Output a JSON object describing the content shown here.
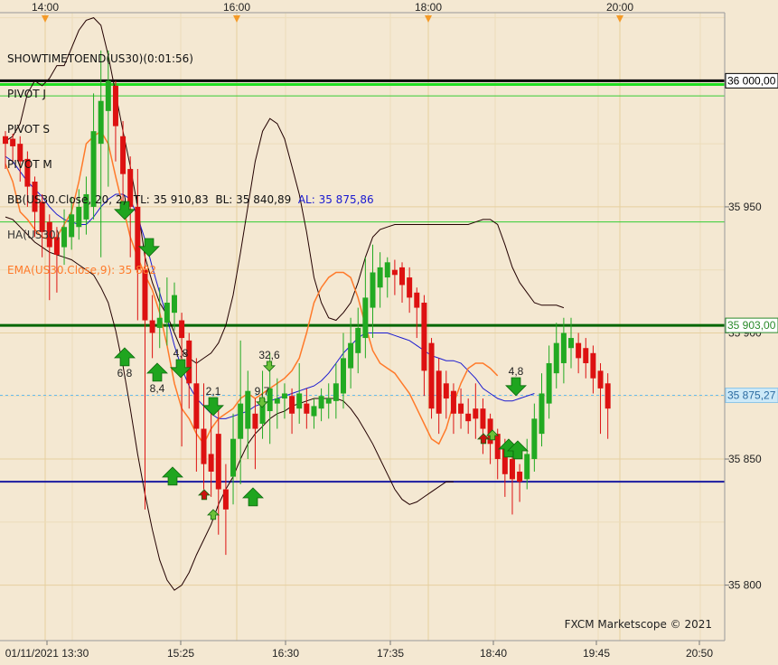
{
  "chart_data": {
    "type": "candlestick",
    "instrument": "US30",
    "y_range": [
      35778,
      36027
    ],
    "y_ticks": [
      {
        "value": 35800,
        "label": "35 800"
      },
      {
        "value": 35850,
        "label": "35 850"
      },
      {
        "value": 35900,
        "label": "35 900"
      },
      {
        "value": 35950,
        "label": "35 950"
      }
    ],
    "top_time_labels": [
      "14:00",
      "16:00",
      "18:00",
      "20:00"
    ],
    "bottom_time_labels": [
      "01/11/2021 13:30",
      "15:25",
      "16:30",
      "17:35",
      "18:40",
      "19:45",
      "20:50"
    ],
    "legend": [
      "SHOWTIMETOEND(US30)(0:01:56)",
      "PIVOT J",
      "PIVOT S",
      "PIVOT M",
      "BB(US30.Close, 20, 2)  TL: 35 910,83  BL: 35 840,89  AL: 35 875,86",
      "HA(US30)",
      "EMA(US30.Close,9): 35 882"
    ],
    "levels": [
      {
        "name": "PIVOT J",
        "value": 36000,
        "label": "36 000,00",
        "color": "#000000"
      },
      {
        "name": "PIVOT J zone",
        "value": 35998.5,
        "color": "#22dd22"
      },
      {
        "name": "PIVOT S",
        "value": 35994,
        "color": "#33cc33"
      },
      {
        "name": "PIVOT M",
        "value": 35944,
        "color": "#33cc33"
      },
      {
        "name": "PIVOT",
        "value": 35903,
        "label": "35 903,00",
        "color": "#006600"
      },
      {
        "name": "support",
        "value": 35841,
        "color": "#1a1aa0"
      },
      {
        "name": "current",
        "value": 35875.27,
        "label": "35 875,27",
        "color": "#66bbee"
      }
    ],
    "candles": [
      {
        "o": 35978,
        "c": 35975,
        "h": 35980,
        "l": 35965
      },
      {
        "o": 35977,
        "c": 35974,
        "h": 35979,
        "l": 35968
      },
      {
        "o": 35975,
        "c": 35968,
        "h": 35978,
        "l": 35960
      },
      {
        "o": 35969,
        "c": 35958,
        "h": 35972,
        "l": 35950
      },
      {
        "o": 35960,
        "c": 35948,
        "h": 35962,
        "l": 35938
      },
      {
        "o": 35952,
        "c": 35940,
        "h": 35955,
        "l": 35930
      },
      {
        "o": 35944,
        "c": 35934,
        "h": 35947,
        "l": 35913
      },
      {
        "o": 35938,
        "c": 35931,
        "h": 35942,
        "l": 35916
      },
      {
        "o": 35934,
        "c": 35942,
        "h": 35949,
        "l": 35927
      },
      {
        "o": 35938,
        "c": 35947,
        "h": 35954,
        "l": 35933
      },
      {
        "o": 35942,
        "c": 35950,
        "h": 35957,
        "l": 35937
      },
      {
        "o": 35945,
        "c": 35955,
        "h": 35962,
        "l": 35939
      },
      {
        "o": 35950,
        "c": 35980,
        "h": 35995,
        "l": 35945
      },
      {
        "o": 35975,
        "c": 35992,
        "h": 36012,
        "l": 35930
      },
      {
        "o": 35988,
        "c": 36000,
        "h": 36012,
        "l": 35958
      },
      {
        "o": 35998,
        "c": 35982,
        "h": 36000,
        "l": 35968
      },
      {
        "o": 35978,
        "c": 35963,
        "h": 35984,
        "l": 35950
      },
      {
        "o": 35965,
        "c": 35950,
        "h": 35970,
        "l": 35930
      },
      {
        "o": 35950,
        "c": 35925,
        "h": 35965,
        "l": 35905
      },
      {
        "o": 35925,
        "c": 35905,
        "h": 35935,
        "l": 35830
      },
      {
        "o": 35905,
        "c": 35900,
        "h": 35915,
        "l": 35890
      },
      {
        "o": 35902,
        "c": 35906,
        "h": 35918,
        "l": 35894
      },
      {
        "o": 35904,
        "c": 35912,
        "h": 35922,
        "l": 35895
      },
      {
        "o": 35908,
        "c": 35915,
        "h": 35920,
        "l": 35901
      },
      {
        "o": 35905,
        "c": 35898,
        "h": 35908,
        "l": 35855
      },
      {
        "o": 35897,
        "c": 35880,
        "h": 35900,
        "l": 35870
      },
      {
        "o": 35880,
        "c": 35862,
        "h": 35890,
        "l": 35845
      },
      {
        "o": 35862,
        "c": 35848,
        "h": 35880,
        "l": 35838
      },
      {
        "o": 35852,
        "c": 35845,
        "h": 35870,
        "l": 35835
      },
      {
        "o": 35860,
        "c": 35838,
        "h": 35870,
        "l": 35820
      },
      {
        "o": 35838,
        "c": 35830,
        "h": 35848,
        "l": 35812
      },
      {
        "o": 35843,
        "c": 35858,
        "h": 35868,
        "l": 35832
      },
      {
        "o": 35858,
        "c": 35872,
        "h": 35897,
        "l": 35840
      },
      {
        "o": 35862,
        "c": 35877,
        "h": 35885,
        "l": 35850
      },
      {
        "o": 35868,
        "c": 35862,
        "h": 35874,
        "l": 35846
      },
      {
        "o": 35864,
        "c": 35874,
        "h": 35885,
        "l": 35858
      },
      {
        "o": 35869,
        "c": 35878,
        "h": 35892,
        "l": 35856
      },
      {
        "o": 35872,
        "c": 35874,
        "h": 35882,
        "l": 35862
      },
      {
        "o": 35874,
        "c": 35876,
        "h": 35880,
        "l": 35866
      },
      {
        "o": 35875,
        "c": 35868,
        "h": 35878,
        "l": 35860
      },
      {
        "o": 35870,
        "c": 35876,
        "h": 35888,
        "l": 35864
      },
      {
        "o": 35872,
        "c": 35868,
        "h": 35878,
        "l": 35862
      },
      {
        "o": 35867,
        "c": 35871,
        "h": 35874,
        "l": 35862
      },
      {
        "o": 35870,
        "c": 35875,
        "h": 35878,
        "l": 35865
      },
      {
        "o": 35872,
        "c": 35874,
        "h": 35880,
        "l": 35866
      },
      {
        "o": 35873,
        "c": 35880,
        "h": 35888,
        "l": 35866
      },
      {
        "o": 35876,
        "c": 35890,
        "h": 35900,
        "l": 35870
      },
      {
        "o": 35886,
        "c": 35896,
        "h": 35906,
        "l": 35878
      },
      {
        "o": 35892,
        "c": 35902,
        "h": 35910,
        "l": 35884
      },
      {
        "o": 35898,
        "c": 35914,
        "h": 35930,
        "l": 35890
      },
      {
        "o": 35910,
        "c": 35924,
        "h": 35935,
        "l": 35898
      },
      {
        "o": 35918,
        "c": 35926,
        "h": 35932,
        "l": 35910
      },
      {
        "o": 35922,
        "c": 35928,
        "h": 35930,
        "l": 35914
      },
      {
        "o": 35925,
        "c": 35923,
        "h": 35929,
        "l": 35915
      },
      {
        "o": 35926,
        "c": 35919,
        "h": 35928,
        "l": 35912
      },
      {
        "o": 35922,
        "c": 35914,
        "h": 35926,
        "l": 35908
      },
      {
        "o": 35916,
        "c": 35910,
        "h": 35918,
        "l": 35898
      },
      {
        "o": 35912,
        "c": 35885,
        "h": 35915,
        "l": 35875
      },
      {
        "o": 35896,
        "c": 35870,
        "h": 35898,
        "l": 35866
      },
      {
        "o": 35885,
        "c": 35868,
        "h": 35890,
        "l": 35860
      },
      {
        "o": 35880,
        "c": 35874,
        "h": 35885,
        "l": 35866
      },
      {
        "o": 35877,
        "c": 35868,
        "h": 35880,
        "l": 35860
      },
      {
        "o": 35872,
        "c": 35868,
        "h": 35878,
        "l": 35862
      },
      {
        "o": 35868,
        "c": 35865,
        "h": 35874,
        "l": 35860
      },
      {
        "o": 35870,
        "c": 35866,
        "h": 35880,
        "l": 35858
      },
      {
        "o": 35870,
        "c": 35862,
        "h": 35874,
        "l": 35852
      },
      {
        "o": 35866,
        "c": 35856,
        "h": 35868,
        "l": 35848
      },
      {
        "o": 35860,
        "c": 35850,
        "h": 35862,
        "l": 35842
      },
      {
        "o": 35855,
        "c": 35844,
        "h": 35858,
        "l": 35835
      },
      {
        "o": 35850,
        "c": 35842,
        "h": 35852,
        "l": 35828
      },
      {
        "o": 35845,
        "c": 35841,
        "h": 35848,
        "l": 35833
      },
      {
        "o": 35842,
        "c": 35852,
        "h": 35858,
        "l": 35838
      },
      {
        "o": 35850,
        "c": 35866,
        "h": 35872,
        "l": 35845
      },
      {
        "o": 35860,
        "c": 35876,
        "h": 35884,
        "l": 35855
      },
      {
        "o": 35872,
        "c": 35888,
        "h": 35895,
        "l": 35866
      },
      {
        "o": 35884,
        "c": 35896,
        "h": 35904,
        "l": 35878
      },
      {
        "o": 35888,
        "c": 35900,
        "h": 35906,
        "l": 35880
      },
      {
        "o": 35894,
        "c": 35898,
        "h": 35906,
        "l": 35886
      },
      {
        "o": 35896,
        "c": 35890,
        "h": 35900,
        "l": 35884
      },
      {
        "o": 35894,
        "c": 35888,
        "h": 35898,
        "l": 35882
      },
      {
        "o": 35892,
        "c": 35882,
        "h": 35895,
        "l": 35876
      },
      {
        "o": 35885,
        "c": 35878,
        "h": 35888,
        "l": 35860
      },
      {
        "o": 35880,
        "c": 35870,
        "h": 35884,
        "l": 35858
      }
    ],
    "bb_upper": [
      35976,
      35978,
      35983,
      35995,
      36000,
      35998,
      36001,
      36006,
      36006,
      36013,
      36020,
      36024,
      36025,
      36022,
      36010,
      35995,
      35980,
      35966,
      35950,
      35930,
      35920,
      35912,
      35907,
      35900,
      35893,
      35890,
      35888,
      35890,
      35892,
      35896,
      35903,
      35915,
      35932,
      35950,
      35968,
      35980,
      35985,
      35983,
      35977,
      35966,
      35955,
      35940,
      35922,
      35912,
      35906,
      35905,
      35908,
      35912,
      35920,
      35930,
      35938,
      35941,
      35942,
      35943,
      35943,
      35943,
      35943,
      35943,
      35943,
      35943,
      35943,
      35943,
      35943,
      35943,
      35944,
      35945,
      35945,
      35943,
      35935,
      35926,
      35920,
      35916,
      35912,
      35911,
      35911,
      35911,
      35910
    ],
    "bb_middle": [
      35970,
      35968,
      35964,
      35960,
      35957,
      35954,
      35950,
      35947,
      35945,
      35944,
      35943,
      35943,
      35946,
      35950,
      35953,
      35955,
      35955,
      35953,
      35946,
      35937,
      35926,
      35916,
      35906,
      35895,
      35886,
      35879,
      35874,
      35871,
      35868,
      35866,
      35866,
      35867,
      35868,
      35869,
      35871,
      35872,
      35873,
      35874,
      35875,
      35876,
      35877,
      35878,
      35879,
      35881,
      35884,
      35888,
      35892,
      35895,
      35898,
      35900,
      35900,
      35900,
      35900,
      35899,
      35898,
      35897,
      35895,
      35893,
      35891,
      35890,
      35889,
      35889,
      35888,
      35885,
      35882,
      35878,
      35876,
      35874,
      35873,
      35873,
      35874,
      35875,
      35876
    ],
    "bb_lower": [
      35946,
      35945,
      35942,
      35939,
      35936,
      35934,
      35932,
      35931,
      35930,
      35929,
      35927,
      35925,
      35923,
      35918,
      35912,
      35901,
      35887,
      35870,
      35852,
      35836,
      35822,
      35810,
      35802,
      35798,
      35800,
      35805,
      35812,
      35818,
      35824,
      35832,
      35838,
      35843,
      35850,
      35856,
      35860,
      35863,
      35866,
      35868,
      35869,
      35871,
      35872,
      35873,
      35874,
      35874,
      35874,
      35874,
      35873,
      35870,
      35866,
      35861,
      35856,
      35850,
      35844,
      35838,
      35834,
      35832,
      35833,
      35835,
      35837,
      35839,
      35841,
      35841
    ],
    "ema": [
      35967,
      35960,
      35948,
      35945,
      35941,
      35938,
      35937,
      35938,
      35943,
      35948,
      35960,
      35975,
      35978,
      35980,
      35975,
      35962,
      35950,
      35938,
      35930,
      35923,
      35917,
      35908,
      35895,
      35880,
      35870,
      35866,
      35860,
      35856,
      35862,
      35866,
      35868,
      35870,
      35874,
      35876,
      35874,
      35876,
      35878,
      35880,
      35882,
      35885,
      35890,
      35900,
      35912,
      35918,
      35922,
      35924,
      35924,
      35922,
      35914,
      35903,
      35893,
      35888,
      35886,
      35884,
      35880,
      35876,
      35870,
      35864,
      35858,
      35856,
      35862,
      35872,
      35880,
      35886,
      35888,
      35888,
      35886,
      35883
    ],
    "signals": [
      {
        "label": "6,8",
        "dir": "up",
        "big": true
      },
      {
        "label": "",
        "dir": "down",
        "big": true
      },
      {
        "label": "",
        "dir": "down",
        "big": true
      },
      {
        "label": "8,4",
        "dir": "up",
        "big": true
      },
      {
        "label": "4,8",
        "dir": "down",
        "big": true
      },
      {
        "label": "2,1",
        "dir": "down",
        "big": true
      },
      {
        "label": "",
        "dir": "up",
        "big": true
      },
      {
        "label": "",
        "dir": "up",
        "big": false,
        "red": true
      },
      {
        "label": "",
        "dir": "up",
        "big": false
      },
      {
        "label": "",
        "dir": "up",
        "big": true
      },
      {
        "label": "32,6",
        "dir": "down",
        "big": false
      },
      {
        "label": "9,7",
        "dir": "down",
        "big": false
      },
      {
        "label": "4,8",
        "dir": "down",
        "big": true
      },
      {
        "label": "",
        "dir": "up",
        "big": false,
        "red": true
      },
      {
        "label": "",
        "dir": "up",
        "big": false
      },
      {
        "label": "",
        "dir": "up",
        "big": true
      },
      {
        "label": "",
        "dir": "up",
        "big": true
      }
    ],
    "copyright": "FXCM Marketscope © 2021",
    "colors": {
      "background": "#f4e8d2",
      "bull": "#22aa22",
      "bear": "#dd1111",
      "bb": "#220000",
      "ma": "#1a1ad0",
      "ema": "#ff7a2a",
      "grid": "#e6cf9f",
      "marker": "#f49a28"
    }
  }
}
